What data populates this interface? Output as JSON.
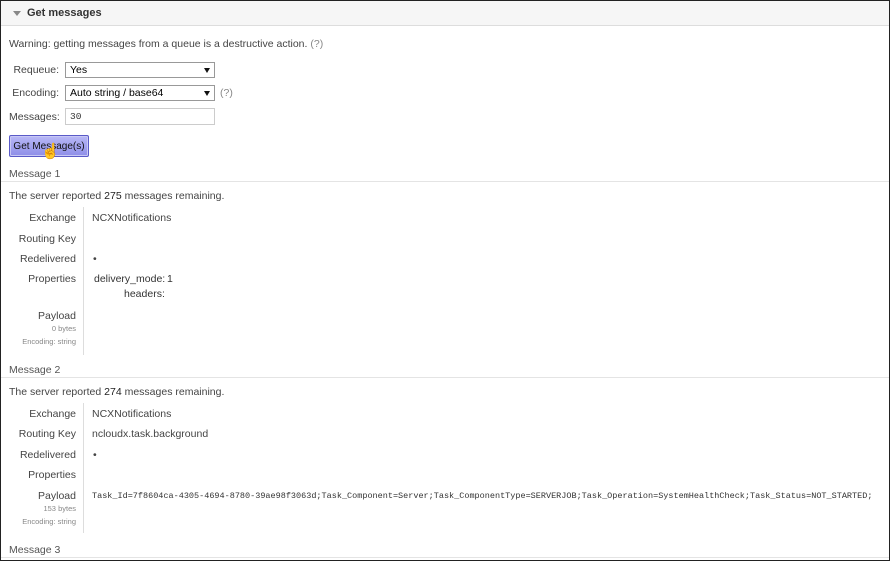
{
  "section": {
    "title": "Get messages"
  },
  "warning": {
    "text": "Warning: getting messages from a queue is a destructive action.",
    "help": "(?)"
  },
  "form": {
    "requeue_label": "Requeue:",
    "requeue_value": "Yes",
    "encoding_label": "Encoding:",
    "encoding_value": "Auto string / base64",
    "encoding_help": "(?)",
    "messages_label": "Messages:",
    "messages_value": "30",
    "get_button": "Get Message(s)"
  },
  "messages": [
    {
      "header": "Message 1",
      "server_prefix": "The server reported ",
      "remaining": "275",
      "server_suffix": " messages remaining.",
      "exchange_label": "Exchange",
      "exchange": "NCXNotifications",
      "routing_key_label": "Routing Key",
      "routing_key": "",
      "redelivered_label": "Redelivered",
      "redelivered": "•",
      "properties_label": "Properties",
      "properties": {
        "delivery_mode_label": "delivery_mode:",
        "delivery_mode": "1",
        "headers_label": "headers:"
      },
      "payload_label": "Payload",
      "payload_bytes": "0 bytes",
      "payload_encoding": "Encoding: string",
      "payload": ""
    },
    {
      "header": "Message 2",
      "server_prefix": "The server reported ",
      "remaining": "274",
      "server_suffix": " messages remaining.",
      "exchange_label": "Exchange",
      "exchange": "NCXNotifications",
      "routing_key_label": "Routing Key",
      "routing_key": "ncloudx.task.background",
      "redelivered_label": "Redelivered",
      "redelivered": "•",
      "properties_label": "Properties",
      "payload_label": "Payload",
      "payload_bytes": "153 bytes",
      "payload_encoding": "Encoding: string",
      "payload": "Task_Id=7f8604ca-4305-4694-8780-39ae98f3063d;Task_Component=Server;Task_ComponentType=SERVERJOB;Task_Operation=SystemHealthCheck;Task_Status=NOT_STARTED;"
    },
    {
      "header": "Message 3"
    }
  ]
}
